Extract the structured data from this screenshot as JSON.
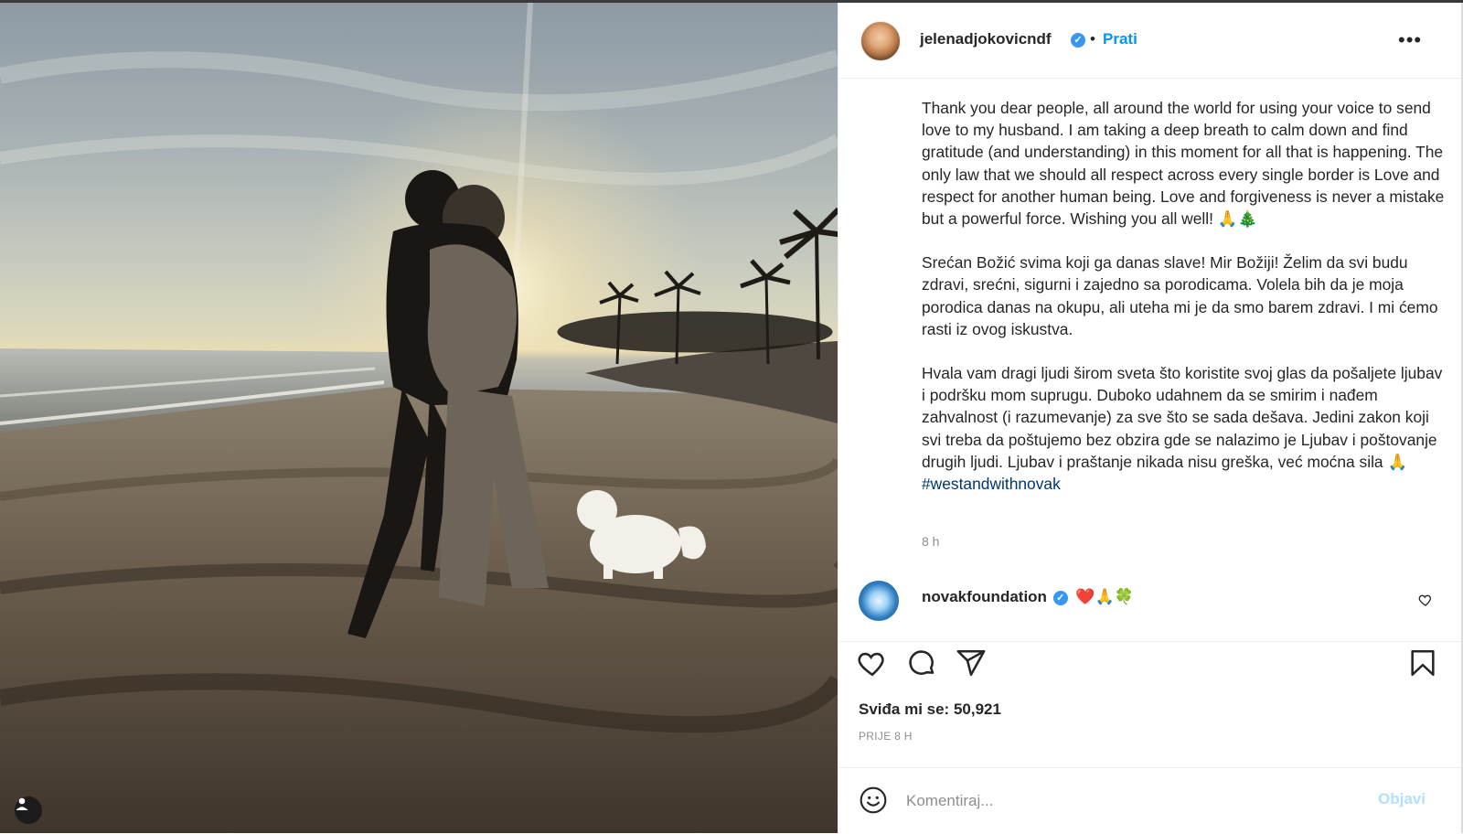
{
  "post": {
    "username": "jelenadjokovicndf",
    "separator": "•",
    "follow_label": "Prati",
    "more_label": "•••",
    "caption_paragraphs": [
      "Thank you dear people, all around the world for using your voice to send love to my husband. I am taking a deep breath to calm down and find gratitude (and understanding) in this moment for all that is happening. The only law that we should all respect across every single border is Love and respect for another human being. Love and forgiveness is never a mistake but a powerful force. Wishing you all well! 🙏🎄",
      "Srećan Božić svima koji ga danas slave! Mir Božiji! Želim da svi budu zdravi, srećni, sigurni i zajedno sa porodicama. Volela bih da je moja porodica danas na okupu, ali uteha mi je da smo barem zdravi. I mi ćemo rasti iz ovog iskustva.",
      "Hvala vam dragi ljudi širom sveta što koristite svoj glas da pošaljete ljubav i podršku mom suprugu. Duboko udahnem da se smirim i nađem zahvalnost (i razumevanje) za sve što se sada dešava. Jedini zakon koji svi treba da poštujemo bez obzira gde se nalazimo je Ljubav i poštovanje drugih ljudi. Ljubav i praštanje nikada nisu greška, već moćna sila 🙏"
    ],
    "hashtag": "#westandwithnovak",
    "caption_time": "8 h"
  },
  "comment": {
    "username": "novakfoundation",
    "text": "❤️🙏🍀"
  },
  "engagement": {
    "likes_label": "Sviđa mi se:",
    "likes_count": "50,921",
    "posted_ago": "PRIJE 8 H"
  },
  "add_comment": {
    "placeholder": "Komentiraj...",
    "post_label": "Objavi"
  },
  "icons": {
    "verified": "verified-badge-icon",
    "like": "heart-icon",
    "comment": "comment-icon",
    "share": "send-icon",
    "save": "bookmark-icon",
    "emoji": "emoji-icon",
    "user": "user-tag-icon"
  },
  "colors": {
    "accent": "#0095f6",
    "verified": "#3897f0",
    "hashtag": "#00376b",
    "muted": "#8e8e8e",
    "post_disabled": "#b2dffc"
  }
}
